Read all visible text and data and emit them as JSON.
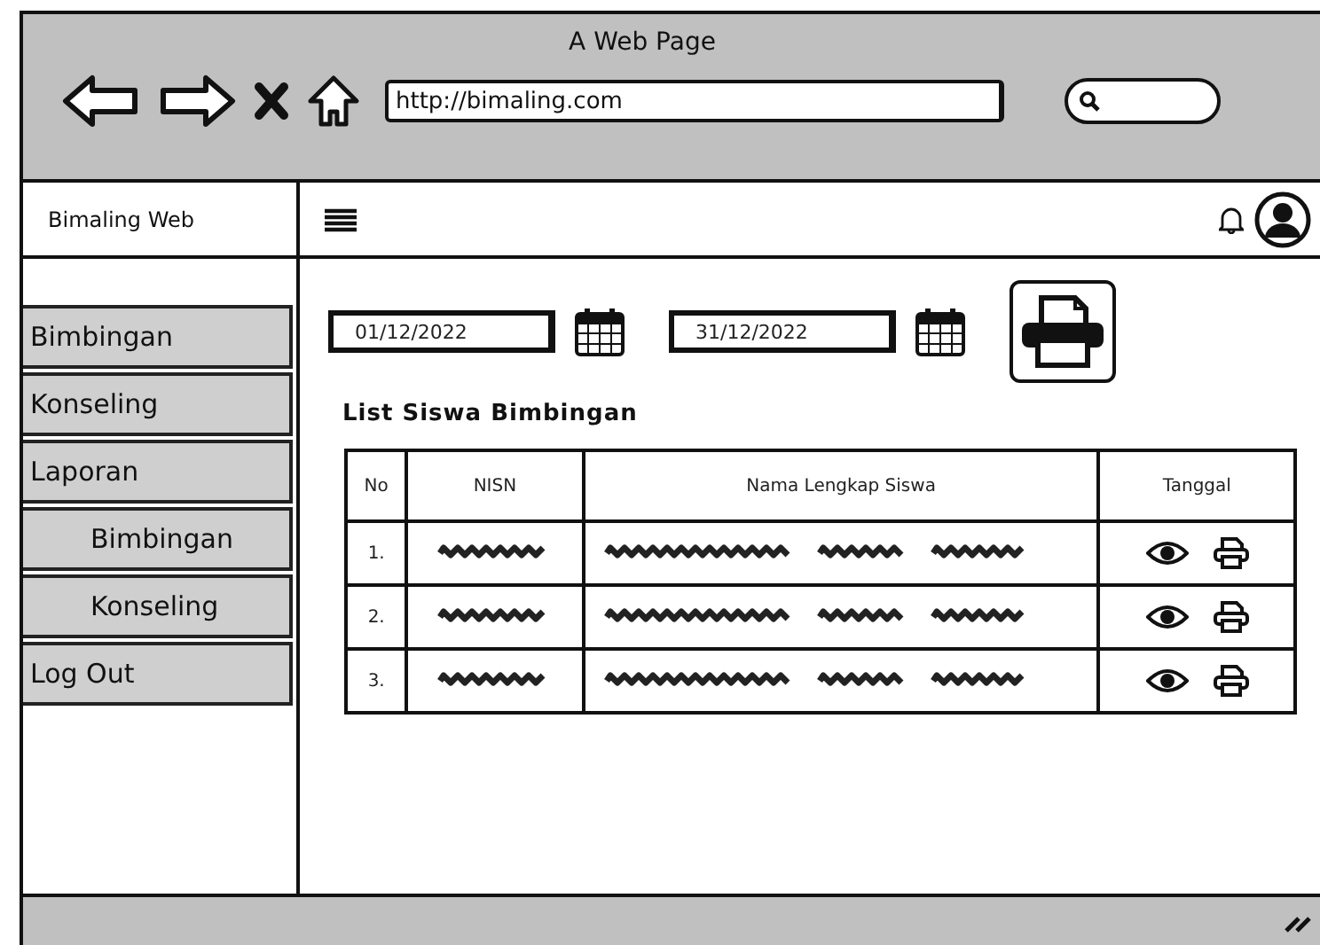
{
  "window": {
    "title": "A Web Page",
    "url": "http://bimaling.com"
  },
  "sidebar": {
    "brand": "Bimaling Web",
    "items": [
      {
        "label": "Bimbingan"
      },
      {
        "label": "Konseling"
      },
      {
        "label": "Laporan",
        "children": [
          {
            "label": "Bimbingan"
          },
          {
            "label": "Konseling"
          }
        ]
      },
      {
        "label": "Log Out"
      }
    ]
  },
  "filters": {
    "start_date": "01/12/2022",
    "end_date": "31/12/2022"
  },
  "list_title": "List Siswa Bimbingan",
  "table": {
    "columns": [
      "No",
      "NISN",
      "Nama Lengkap Siswa",
      "Tanggal"
    ],
    "rows": [
      {
        "no": "1."
      },
      {
        "no": "2."
      },
      {
        "no": "3."
      }
    ]
  }
}
